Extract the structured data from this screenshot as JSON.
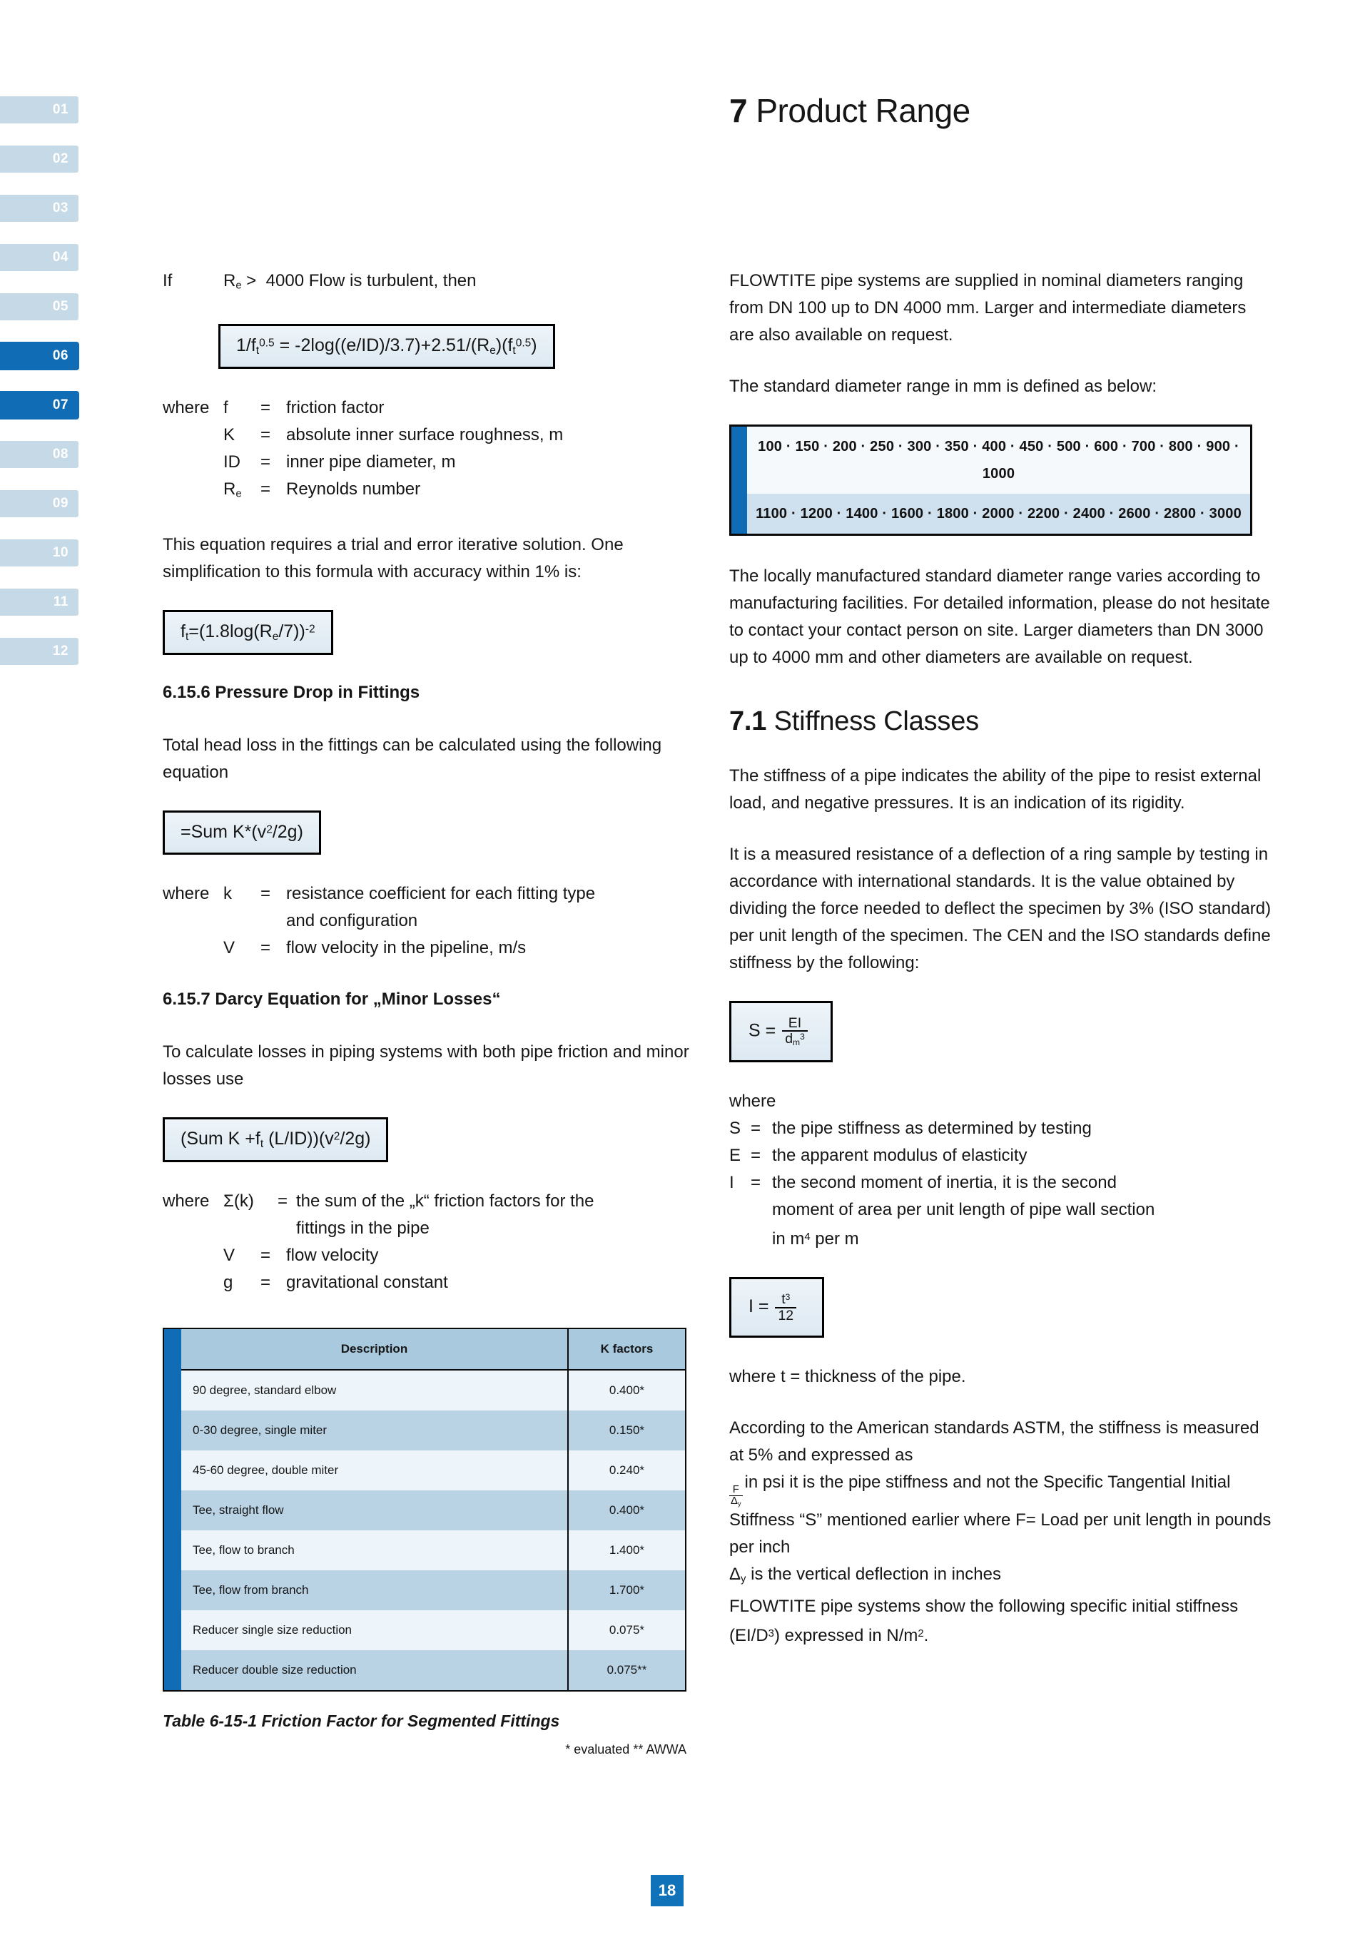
{
  "tabs": [
    {
      "label": "01",
      "active": false
    },
    {
      "label": "02",
      "active": false
    },
    {
      "label": "03",
      "active": false
    },
    {
      "label": "04",
      "active": false
    },
    {
      "label": "05",
      "active": false
    },
    {
      "label": "06",
      "active": true
    },
    {
      "label": "07",
      "active": true
    },
    {
      "label": "08",
      "active": false
    },
    {
      "label": "09",
      "active": false
    },
    {
      "label": "10",
      "active": false
    },
    {
      "label": "11",
      "active": false
    },
    {
      "label": "12",
      "active": false
    }
  ],
  "header": {
    "chapter_number": "7",
    "title": " Product Range"
  },
  "left": {
    "turbulent_line": {
      "lead": "If",
      "symbol": "R",
      "symbol_sub": "e",
      "rest": ">   4000 Flow is turbulent, then"
    },
    "formula_colebrook": "1/f<sub>t</sub><sup>0.5</sup> = -2log((e/ID)/3.7)+2.51/(R<sub>e</sub>)(f<sub>t</sub><sup>0.5</sup>)",
    "where_label": "where",
    "defs1": [
      {
        "sym": "f",
        "eq": "=",
        "txt": "friction factor"
      },
      {
        "sym": "K",
        "eq": "=",
        "txt": "absolute inner surface roughness, m"
      },
      {
        "sym": "ID",
        "eq": "=",
        "txt": "inner pipe diameter, m"
      },
      {
        "sym": "R<sub>e</sub>",
        "eq": "=",
        "txt": "Reynolds number"
      }
    ],
    "para_iterative": "This equation requires a trial and error iterative solution. One simplification to this formula with accuracy within 1% is:",
    "formula_simplified": "f<sub>t</sub>=(1.8log(R<sub>e</sub>/7))<sup>-2</sup>",
    "heading_6156": "6.15.6 Pressure Drop in Fittings",
    "para_head_loss": "Total head loss in the fittings can be calculated using the following equation",
    "formula_sum_k": "=Sum K*(v<sup>2</sup>/2g)",
    "defs2": [
      {
        "sym": "k",
        "eq": "=",
        "txt": "resistance coefficient for each fitting type"
      },
      {
        "sym": "",
        "eq": "",
        "txt": "and configuration",
        "cont": true
      },
      {
        "sym": "V",
        "eq": "=",
        "txt": "flow velocity in the pipeline, m/s"
      }
    ],
    "heading_6157": "6.15.7 Darcy Equation for „Minor Losses“",
    "para_darcy": "To calculate losses in piping systems with both pipe friction and minor losses use",
    "formula_darcy": "(Sum K +f<sub>t</sub> (L/ID))(v<sup>2</sup>/2g)",
    "defs3": [
      {
        "sym": "Σ(k)",
        "eq": "=",
        "txt": "the sum of the „k“ friction factors for the"
      },
      {
        "sym": "",
        "eq": "",
        "txt": "fittings in the pipe",
        "cont": true
      },
      {
        "sym": "V",
        "eq": "=",
        "txt": "flow velocity"
      },
      {
        "sym": "g",
        "eq": "=",
        "txt": "gravitational constant"
      }
    ],
    "table": {
      "headers": [
        "Description",
        "K factors"
      ],
      "rows": [
        [
          "90 degree, standard elbow",
          "0.400*"
        ],
        [
          "0-30 degree, single miter",
          "0.150*"
        ],
        [
          "45-60 degree, double miter",
          "0.240*"
        ],
        [
          "Tee, straight flow",
          "0.400*"
        ],
        [
          "Tee, flow to branch",
          "1.400*"
        ],
        [
          "Tee, flow from branch",
          "1.700*"
        ],
        [
          "Reducer single size reduction",
          "0.075*"
        ],
        [
          "Reducer double size reduction",
          "0.075**"
        ]
      ],
      "caption": "Table 6-15-1 Friction Factor for Segmented Fittings",
      "footnote": "* evaluated   ** AWWA"
    }
  },
  "right": {
    "para_supplied": "FLOWTITE pipe systems are supplied in nominal diameters ranging from DN 100 up to DN 4000 mm. Larger and intermediate diameters are also available on request.",
    "para_standard_range": "The standard diameter range in mm is defined as below:",
    "diameter_row_1": "100 · 150 · 200 · 250 · 300 · 350 · 400 · 450 · 500 · 600 · 700 · 800 · 900 · 1000",
    "diameter_row_2": "1100 · 1200 · 1400 · 1600 · 1800 · 2000 · 2200 · 2400 · 2600 · 2800 · 3000",
    "para_locally": "The locally manufactured standard diameter range varies according to manufacturing facilities. For detailed information, please do not hesitate to contact your contact person on site. Larger diameters than DN 3000 up to 4000 mm and other diameters are available on request.",
    "heading_71_num": "7.1",
    "heading_71_title": " Stiffness Classes",
    "para_stiffness": "The stiffness of a pipe indicates the ability of the pipe to resist external load, and negative pressures. It is an indication of its rigidity.",
    "para_measured": "It is a measured resistance of a deflection of a ring sample by testing in accordance with international standards. It is the value obtained by dividing the force needed to deflect the specimen by 3% (ISO standard) per unit length of the specimen. The CEN and the ISO standards define stiffness by the following:",
    "formula_stiffness": {
      "lhs": "S =",
      "num": "EI",
      "den": "d<sub>m</sub><sup>3</sup>"
    },
    "where_label": "where",
    "defs": [
      {
        "sym": "S",
        "eq": "=",
        "txt": "the pipe stiffness as determined by testing"
      },
      {
        "sym": "E",
        "eq": "=",
        "txt": "the apparent modulus of elasticity"
      },
      {
        "sym": "I",
        "eq": "=",
        "txt": "the second moment of inertia, it is the second"
      },
      {
        "sym": "",
        "eq": "",
        "txt": "moment of area per unit length of pipe wall section",
        "cont": true
      },
      {
        "sym": "",
        "eq": "",
        "txt": "in m<sup>4</sup> per m",
        "cont": true
      }
    ],
    "formula_inertia": {
      "lhs": "I =",
      "num": "t<sup>3</sup>",
      "den": "12"
    },
    "para_thickness": "where t = thickness of the pipe.",
    "para_astm_1": "According to the American standards ASTM, the stiffness is measured at 5% and expressed as",
    "astm_frac": {
      "num": "F",
      "den": "Δ<sub>y</sub>"
    },
    "para_astm_2": "in psi it is the pipe stiffness and not the Specific Tangential Initial Stiffness “S” mentioned earlier where F= Load per unit length in pounds per inch",
    "para_astm_3": "Δ<sub>y</sub> is the vertical deflection in inches",
    "para_astm_4": "FLOWTITE pipe systems show the following specific initial stiffness (EI/D<sup>3</sup>) expressed in N/m<sup>2</sup>."
  },
  "footer": {
    "page_number": "18"
  }
}
